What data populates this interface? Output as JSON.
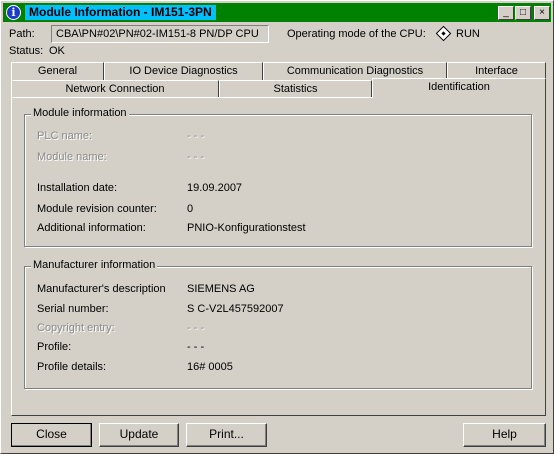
{
  "window": {
    "title": "Module Information - IM151-3PN",
    "min_glyph": "_",
    "max_glyph": "□",
    "close_glyph": "×"
  },
  "header": {
    "path_label": "Path:",
    "path_value": "CBA\\PN#02\\PN#02-IM151-8 PN/DP CPU",
    "mode_label": "Operating mode of the  CPU:",
    "mode_value": "RUN",
    "status_label": "Status:",
    "status_value": "OK"
  },
  "tabs_row1": [
    "General",
    "IO Device Diagnostics",
    "Communication Diagnostics",
    "Interface"
  ],
  "tabs_row2": [
    "Network Connection",
    "Statistics",
    "Identification"
  ],
  "active_tab": "Identification",
  "module_info": {
    "title": "Module information",
    "rows": [
      {
        "label": "PLC name:",
        "value": "- - -",
        "disabled": true
      },
      {
        "label": "Module name:",
        "value": "- - -",
        "disabled": true
      },
      {
        "label": "Installation date:",
        "value": "19.09.2007",
        "disabled": false
      },
      {
        "label": "Module revision counter:",
        "value": "0",
        "disabled": false
      },
      {
        "label": "Additional information:",
        "value": "PNIO-Konfigurationstest",
        "disabled": false
      }
    ]
  },
  "manufacturer_info": {
    "title": "Manufacturer information",
    "rows": [
      {
        "label": "Manufacturer's description",
        "value": "SIEMENS AG",
        "disabled": false
      },
      {
        "label": "Serial number:",
        "value": "S C-V2L457592007",
        "disabled": false
      },
      {
        "label": "Copyright entry:",
        "value": "- - -",
        "disabled": true
      },
      {
        "label": "Profile:",
        "value": "- - -",
        "disabled": false
      },
      {
        "label": "Profile details:",
        "value": "16# 0005",
        "disabled": false
      }
    ]
  },
  "buttons": {
    "close": "Close",
    "update": "Update",
    "print": "Print...",
    "help": "Help"
  }
}
